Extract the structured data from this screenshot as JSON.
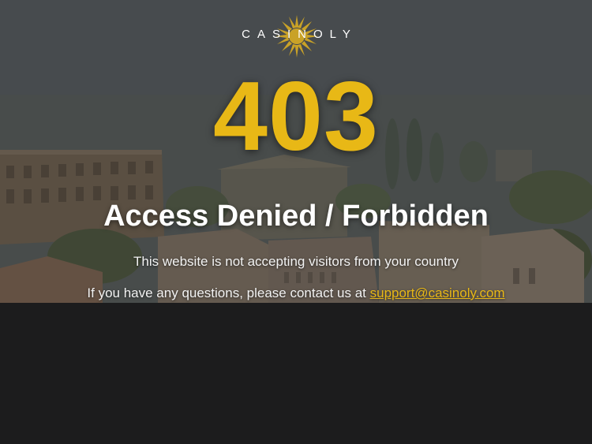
{
  "brand": {
    "name": "CASINOLY",
    "sun_icon": "sun-logo-icon",
    "logo_color": "#ffffff",
    "sun_color": "#c9a227"
  },
  "error": {
    "code": "403",
    "title": "Access Denied / Forbidden",
    "message": "This website is not accepting visitors from your country",
    "contact_prefix": "If you have any questions, please contact us at",
    "contact_email": "support@casinoly.com",
    "accent_color": "#e8b816"
  },
  "background": {
    "scene": "ancient-rome-city-illustration",
    "lower_panel_color": "#1c1c1d"
  }
}
